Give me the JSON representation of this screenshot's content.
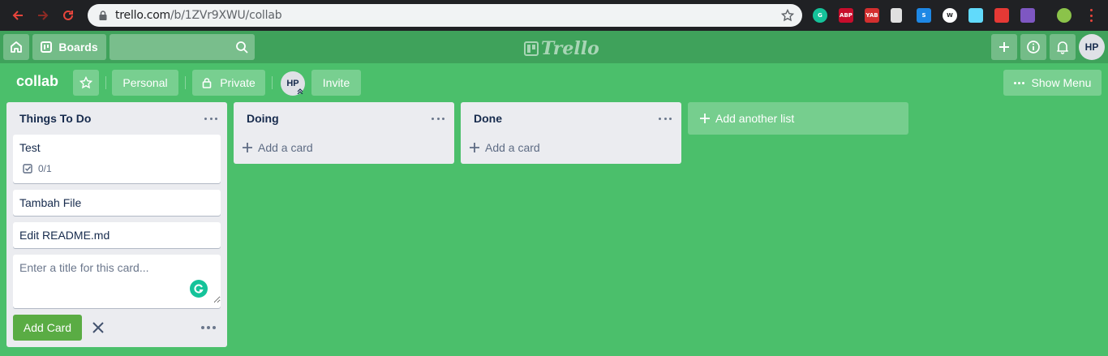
{
  "browser": {
    "url_host": "trello.com",
    "url_path": "/b/1ZVr9XWU/collab",
    "extensions": [
      {
        "name": "grammarly-extension-icon",
        "label": "G",
        "color": "#15c39a"
      },
      {
        "name": "adblock-plus-extension-icon",
        "label": "ABP",
        "color": "#c70d2c"
      },
      {
        "name": "yab-extension-icon",
        "label": "YAB",
        "color": "#d32f2f"
      },
      {
        "name": "document-extension-icon",
        "label": "",
        "color": "#e0e0e0"
      },
      {
        "name": "s-extension-icon",
        "label": "S",
        "color": "#1e88e5"
      },
      {
        "name": "wordpress-extension-icon",
        "label": "W",
        "color": "#ffffff"
      },
      {
        "name": "react-devtools-extension-icon",
        "label": "",
        "color": "#61dafb"
      },
      {
        "name": "blocker-extension-icon",
        "label": "",
        "color": "#e53935"
      },
      {
        "name": "purple-extension-icon",
        "label": "",
        "color": "#7e57c2"
      },
      {
        "name": "profile-extension-icon",
        "label": "",
        "color": "#8bc34a"
      }
    ]
  },
  "header": {
    "boards_label": "Boards",
    "logo_text": "Trello",
    "user_initials": "HP"
  },
  "board": {
    "title": "collab",
    "team_label": "Personal",
    "visibility_label": "Private",
    "member_initials": "HP",
    "invite_label": "Invite",
    "show_menu_label": "Show Menu"
  },
  "lists": [
    {
      "title": "Things To Do",
      "cards": [
        {
          "title": "Test",
          "checklist": "0/1"
        },
        {
          "title": "Tambah File"
        },
        {
          "title": "Edit README.md"
        }
      ],
      "composer_placeholder": "Enter a title for this card...",
      "add_card_button": "Add Card"
    },
    {
      "title": "Doing",
      "add_card_label": "Add a card"
    },
    {
      "title": "Done",
      "add_card_label": "Add a card"
    }
  ],
  "add_list_label": "Add another list",
  "colors": {
    "board_bg": "#4bbf6b",
    "header_bg": "#3fa25b",
    "list_bg": "#ebecf0",
    "add_button": "#5aac44"
  }
}
